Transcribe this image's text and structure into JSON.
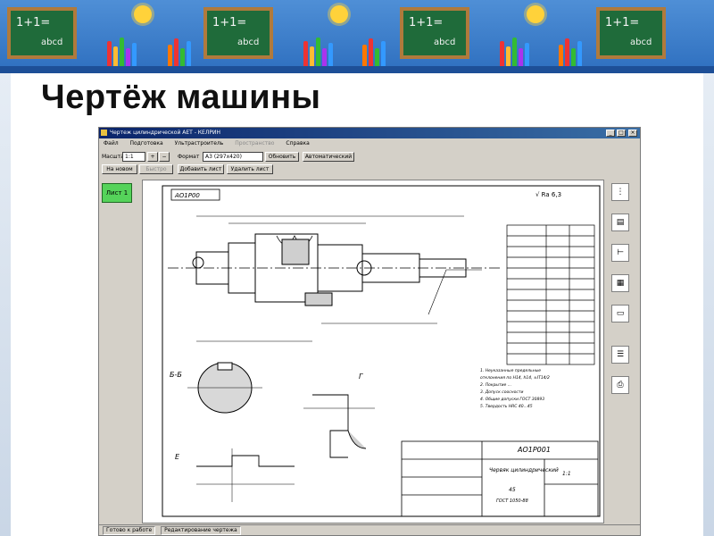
{
  "slide": {
    "title": "Чертёж машины"
  },
  "banner": {
    "board_text_1": "1+1=",
    "board_text_2": "abcd"
  },
  "window": {
    "title": "Чертеж цилиндрической АЕТ - КЕЛРИН",
    "controls": {
      "minimize": "_",
      "maximize": "□",
      "close": "×"
    },
    "menu": [
      "Файл",
      "Подготовка",
      "Ультрастроитель",
      "Пространство",
      "Справка"
    ],
    "toolbar": {
      "scale_label": "Масштаб",
      "scale_value": "1:1",
      "zoom_in_icon": "+",
      "zoom_out_icon": "−",
      "format_label": "Формат",
      "format_value": "А3 (297х420)",
      "button_update": "Обновить",
      "button_auto": "Автоматический",
      "button_new": "На новом",
      "button_fast": "Быстро",
      "button_add_sheet": "Добавить лист",
      "button_delete_sheet": "Удалить лист"
    },
    "sheet_tab": "Лист 1",
    "drawing": {
      "stamp": "АО1Р00",
      "roughness": "√ Ra 6,3",
      "section_bb": "Б-Б",
      "section_v": "Г",
      "section_e": "Е",
      "title_block_code": "АО1Р001",
      "title_block_name": "Червяк цилиндрический",
      "title_block_material": "45",
      "title_block_std": "ГОСТ 1050-88",
      "title_block_scale": "1:1",
      "notes_title": "1. Неуказанные",
      "notes": [
        "1. Неуказанные предельные",
        "отклонения по Н14, h14, ±IT14/2",
        "2. Покрытие ...",
        "3. Допуск соосности",
        "4. Общие допуски ГОСТ 30893",
        "5. Твердость HRC 40...45"
      ]
    },
    "status": [
      "Готово к работе",
      "Редактирование чертежа"
    ]
  },
  "side_tools": [
    "ruler-icon",
    "page-icon",
    "measure-icon",
    "hatch-icon",
    "doc-icon",
    "table-icon",
    "print-icon"
  ]
}
